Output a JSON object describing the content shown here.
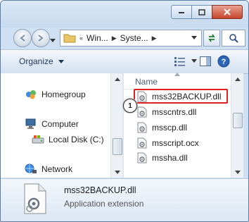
{
  "window": {
    "controls": {
      "minimize": "minimize",
      "maximize": "maximize",
      "close": "close"
    }
  },
  "navigation": {
    "breadcrumb": [
      {
        "label": "Win..."
      },
      {
        "label": "Syste..."
      }
    ]
  },
  "toolbar": {
    "organize_label": "Organize"
  },
  "sidebar": {
    "items": [
      {
        "label": "Homegroup",
        "icon": "homegroup-icon"
      },
      {
        "label": "Computer",
        "icon": "computer-icon"
      },
      {
        "label": "Local Disk (C:)",
        "icon": "drive-icon"
      },
      {
        "label": "Network",
        "icon": "network-icon"
      }
    ]
  },
  "file_list": {
    "column_header": "Name",
    "files": [
      {
        "name": "mss32BACKUP.dll",
        "icon": "dll-file-icon",
        "highlighted": true
      },
      {
        "name": "msscntrs.dll",
        "icon": "dll-file-icon"
      },
      {
        "name": "msscp.dll",
        "icon": "dll-file-icon"
      },
      {
        "name": "msscript.ocx",
        "icon": "dll-file-icon"
      },
      {
        "name": "mssha.dll",
        "icon": "dll-file-icon"
      }
    ],
    "callout_number": "1"
  },
  "details_pane": {
    "file_name": "mss32BACKUP.dll",
    "file_type": "Application extension"
  },
  "colors": {
    "highlight_border": "#e02020",
    "close_button": "#c4432b",
    "chrome": "#cfe0f3"
  }
}
